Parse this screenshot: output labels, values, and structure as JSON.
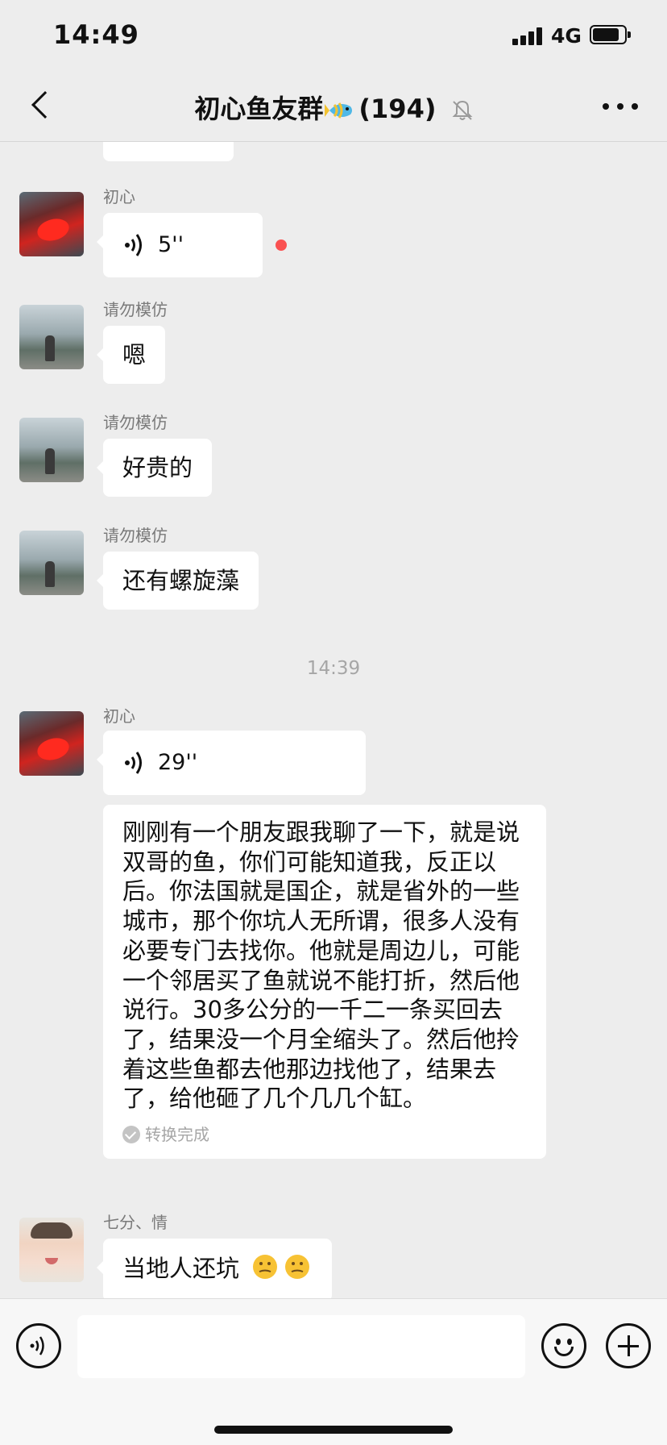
{
  "status_bar": {
    "time": "14:49",
    "network": "4G"
  },
  "header": {
    "title": "初心鱼友群",
    "member_count": "(194)",
    "fish_emoji": "🐠",
    "icons": [
      "back-icon",
      "mute-icon",
      "more-icon"
    ]
  },
  "messages": [
    {
      "sender": "初心",
      "type": "voice",
      "duration": "5''",
      "unread": true
    },
    {
      "sender": "请勿模仿",
      "type": "text",
      "text": "嗯"
    },
    {
      "sender": "请勿模仿",
      "type": "text",
      "text": "好贵的"
    },
    {
      "sender": "请勿模仿",
      "type": "text",
      "text": "还有螺旋藻"
    }
  ],
  "time_divider": "14:39",
  "later_messages": [
    {
      "sender": "初心",
      "type": "voice",
      "duration": "29''",
      "transcript": "刚刚有一个朋友跟我聊了一下，就是说双哥的鱼，你们可能知道我，反正以后。你法国就是国企，就是省外的一些城市，那个你坑人无所谓，很多人没有必要专门去找你。他就是周边儿，可能一个邻居买了鱼就说不能打折，然后他说行。30多公分的一千二一条买回去了，结果没一个月全缩头了。然后他拎着这些鱼都去他那边找他了，结果去了，给他砸了几个几几个缸。",
      "transcript_status": "转换完成"
    },
    {
      "sender": "七分、情",
      "type": "text",
      "text": "当地人还坑",
      "emoji": "🤔🤔"
    }
  ],
  "input_bar": {
    "placeholder": "",
    "icons": [
      "voice-toggle-icon",
      "emoji-icon",
      "plus-icon"
    ]
  }
}
